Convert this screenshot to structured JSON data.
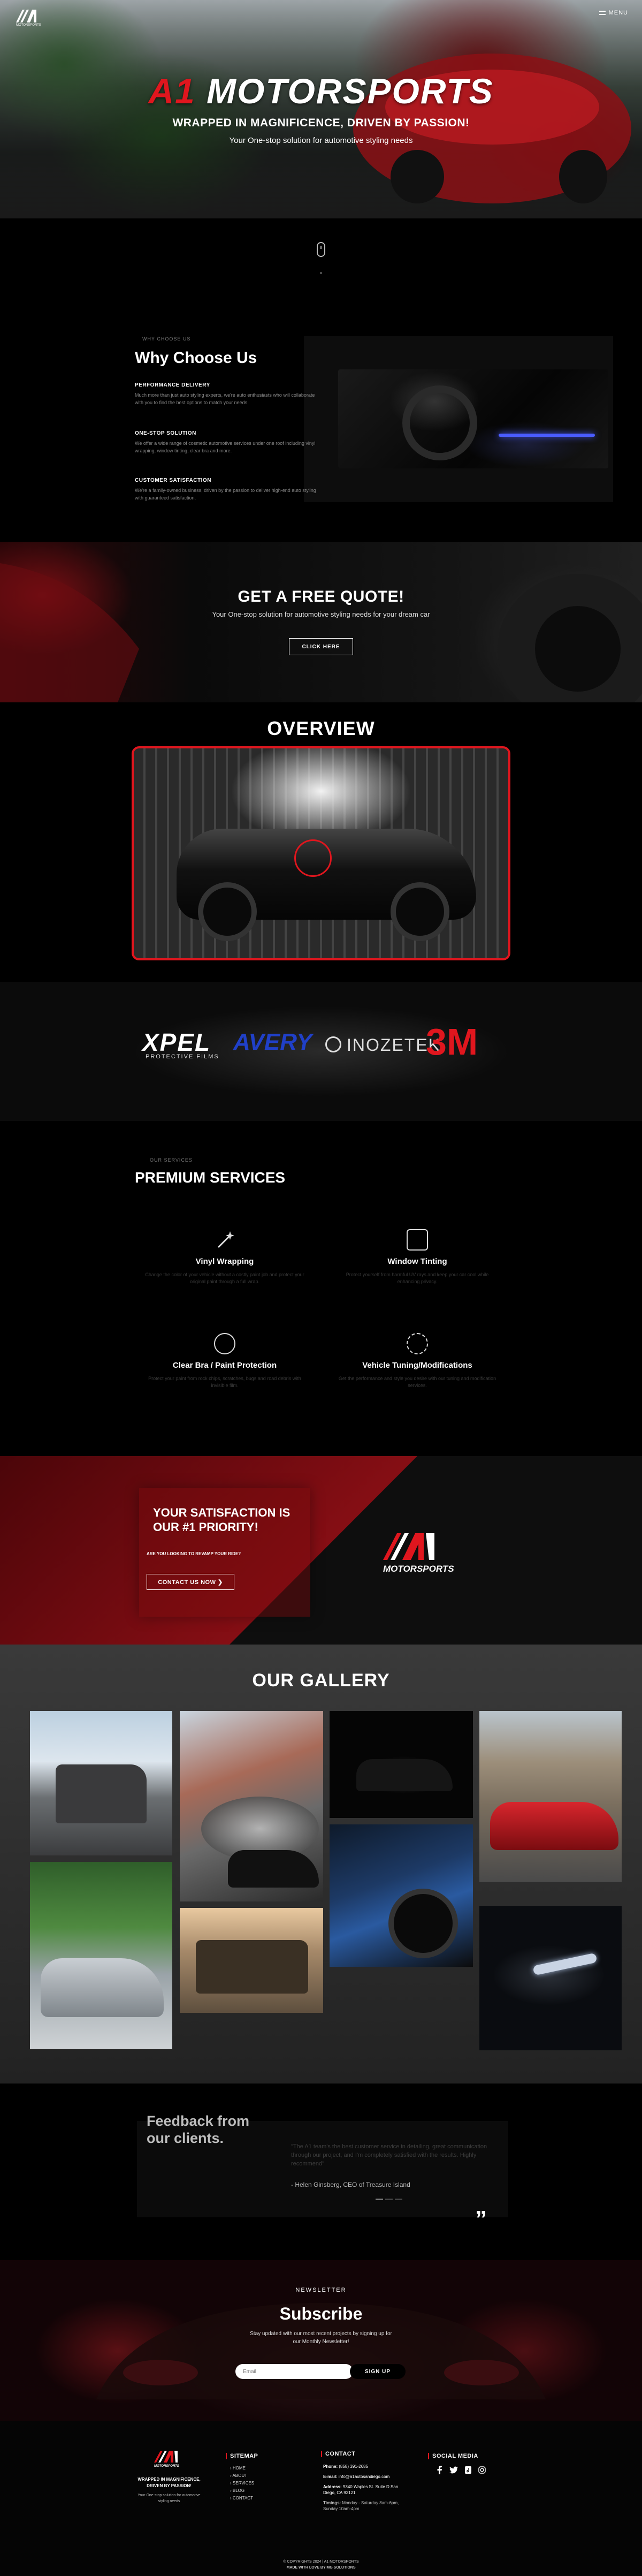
{
  "brand": {
    "logo_text": "A1",
    "logo_sub": "MOTORSPORTS",
    "accent": "#e0161e"
  },
  "nav": {
    "menu_label": "MENU"
  },
  "hero": {
    "title_mark": "A1",
    "title": "MOTORSPORTS",
    "tagline": "WRAPPED IN MAGNIFICENCE, DRIVEN BY PASSION!",
    "subtitle": "Your One-stop solution for automotive styling needs"
  },
  "why": {
    "tag": "WHY CHOOSE US",
    "title": "Why Choose Us",
    "items": [
      {
        "heading": "PERFORMANCE DELIVERY",
        "text": "Much more than just auto styling experts, we're auto enthusiasts who will collaborate with you to find the best options to match your needs."
      },
      {
        "heading": "ONE-STOP SOLUTION",
        "text": "We offer a wide range of cosmetic automotive services under one roof including vinyl wrapping, window tinting, clear bra and more."
      },
      {
        "heading": "CUSTOMER SATISFACTION",
        "text": "We're a family-owned business, driven by the passion to deliver high-end auto styling with guaranteed satisfaction."
      }
    ]
  },
  "quote": {
    "title": "GET A FREE QUOTE!",
    "subtitle": "Your One-stop solution for automotive styling needs for your dream car",
    "button": "CLICK HERE"
  },
  "overview": {
    "title": "OVERVIEW"
  },
  "partners": {
    "xpel": "XPEL",
    "xpel_sub": "PROTECTIVE FILMS",
    "avery": "AVERY",
    "inozetek": "INOZETEK",
    "threem": "3M"
  },
  "services": {
    "tag": "OUR SERVICES",
    "title": "PREMIUM SERVICES",
    "items": [
      {
        "name": "Vinyl Wrapping",
        "text": "Change the color of your vehicle without a costly paint job and protect your original paint through a full wrap."
      },
      {
        "name": "Window Tinting",
        "text": "Protect yourself from harmful UV rays and keep your car cool while enhancing privacy."
      },
      {
        "name": "Clear Bra / Paint Protection",
        "text": "Protect your paint from rock chips, scratches, bugs and road debris with invisible film."
      },
      {
        "name": "Vehicle Tuning/Modifications",
        "text": "Get the performance and style you desire with our tuning and modification services."
      }
    ]
  },
  "satisfaction": {
    "title": "YOUR SATISFACTION IS OUR #1 PRIORITY!",
    "question": "ARE YOU LOOKING TO REVAMP YOUR RIDE?",
    "button": "CONTACT US NOW"
  },
  "gallery": {
    "title": "OUR GALLERY"
  },
  "feedback": {
    "title": "Feedback from our clients.",
    "quote": "\"The A1 team's the best customer service in detailing, great communication through our project, and I'm completely satisfied with the results. Highly recommend\"",
    "author": "- Helen Ginsberg, CEO of Treasure Island",
    "mark": "”"
  },
  "newsletter": {
    "tag": "NEWSLETTER",
    "title": "Subscribe",
    "subtitle": "Stay updated with our most recent projects by signing up for our Monthly Newsletter!",
    "placeholder": "Email",
    "button": "SIGN UP"
  },
  "footer": {
    "tagline": "WRAPPED IN MAGNIFICENCE, DRIVEN BY PASSION!",
    "blurb": "Your One-stop solution for automotive styling needs",
    "sitemap_title": "SITEMAP",
    "sitemap": [
      "HOME",
      "ABOUT",
      "SERVICES",
      "BLOG",
      "CONTACT"
    ],
    "contact_title": "CONTACT",
    "phone_label": "Phone:",
    "phone": "(858) 391-2685",
    "email_label": "E-mail:",
    "email": "info@a1autosandiego.com",
    "address_label": "Address:",
    "address": "9340 Waples St. Suite D San Diego, CA 92121",
    "hours_label": "Timings:",
    "hours": "Monday - Saturday 8am-6pm, Sunday 10am-4pm",
    "social_title": "SOCIAL MEDIA",
    "copyright": "© COPYRIGHTS 2024 | A1 MOTORSPORTS",
    "made_by": "MADE WITH LOVE BY MG SOLUTIONS"
  }
}
